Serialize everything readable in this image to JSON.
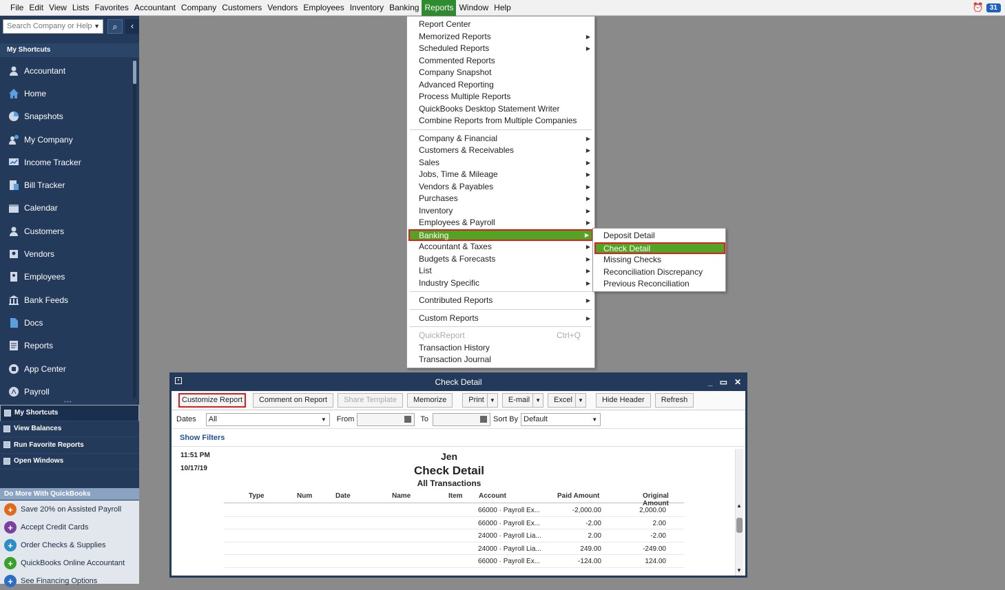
{
  "menubar": {
    "items": [
      "File",
      "Edit",
      "View",
      "Lists",
      "Favorites",
      "Accountant",
      "Company",
      "Customers",
      "Vendors",
      "Employees",
      "Inventory",
      "Banking",
      "Reports",
      "Window",
      "Help"
    ],
    "active_index": 12,
    "badge": "31"
  },
  "sidebar": {
    "search_placeholder": "Search Company or Help",
    "title": "My Shortcuts",
    "items": [
      {
        "label": "Accountant",
        "icon": "person-icon"
      },
      {
        "label": "Home",
        "icon": "home-icon"
      },
      {
        "label": "Snapshots",
        "icon": "pie-chart-icon"
      },
      {
        "label": "My Company",
        "icon": "company-icon"
      },
      {
        "label": "Income Tracker",
        "icon": "income-icon"
      },
      {
        "label": "Bill Tracker",
        "icon": "bill-icon"
      },
      {
        "label": "Calendar",
        "icon": "calendar-icon"
      },
      {
        "label": "Customers",
        "icon": "person-icon"
      },
      {
        "label": "Vendors",
        "icon": "vendor-icon"
      },
      {
        "label": "Employees",
        "icon": "employees-icon"
      },
      {
        "label": "Bank Feeds",
        "icon": "bank-icon"
      },
      {
        "label": "Docs",
        "icon": "doc-icon"
      },
      {
        "label": "Reports",
        "icon": "reports-icon"
      },
      {
        "label": "App Center",
        "icon": "app-icon"
      },
      {
        "label": "Payroll",
        "icon": "payroll-icon"
      }
    ],
    "nav": [
      "My Shortcuts",
      "View Balances",
      "Run Favorite Reports",
      "Open Windows"
    ],
    "domore_title": "Do More With QuickBooks",
    "domore": [
      {
        "label": "Save 20% on Assisted Payroll",
        "color": "#e06a1b"
      },
      {
        "label": "Accept Credit Cards",
        "color": "#7a3fa0"
      },
      {
        "label": "Order Checks & Supplies",
        "color": "#2c8ec4"
      },
      {
        "label": "QuickBooks Online Accountant",
        "color": "#3aa02c"
      },
      {
        "label": "See Financing Options",
        "color": "#2c6ec4"
      }
    ]
  },
  "reports_menu": {
    "items": [
      {
        "label": "Report Center",
        "arrow": false
      },
      {
        "label": "Memorized Reports",
        "arrow": true
      },
      {
        "label": "Scheduled Reports",
        "arrow": true
      },
      {
        "label": "Commented Reports",
        "arrow": false
      },
      {
        "label": "Company Snapshot",
        "arrow": false
      },
      {
        "label": "Advanced Reporting",
        "arrow": false
      },
      {
        "label": "Process Multiple Reports",
        "arrow": false
      },
      {
        "label": "QuickBooks Desktop Statement Writer",
        "arrow": false
      },
      {
        "label": "Combine Reports from Multiple Companies",
        "arrow": false
      },
      {
        "sep": true
      },
      {
        "label": "Company & Financial",
        "arrow": true
      },
      {
        "label": "Customers & Receivables",
        "arrow": true
      },
      {
        "label": "Sales",
        "arrow": true
      },
      {
        "label": "Jobs, Time & Mileage",
        "arrow": true
      },
      {
        "label": "Vendors & Payables",
        "arrow": true
      },
      {
        "label": "Purchases",
        "arrow": true
      },
      {
        "label": "Inventory",
        "arrow": true
      },
      {
        "label": "Employees & Payroll",
        "arrow": true
      },
      {
        "label": "Banking",
        "arrow": true,
        "highlight": true
      },
      {
        "label": "Accountant & Taxes",
        "arrow": true
      },
      {
        "label": "Budgets & Forecasts",
        "arrow": true
      },
      {
        "label": "List",
        "arrow": true
      },
      {
        "label": "Industry Specific",
        "arrow": true
      },
      {
        "sep": true
      },
      {
        "label": "Contributed Reports",
        "arrow": true
      },
      {
        "sep": true
      },
      {
        "label": "Custom Reports",
        "arrow": true
      },
      {
        "sep": true
      },
      {
        "label": "QuickReport",
        "arrow": false,
        "disabled": true,
        "shortcut": "Ctrl+Q"
      },
      {
        "label": "Transaction History",
        "arrow": false
      },
      {
        "label": "Transaction Journal",
        "arrow": false
      }
    ]
  },
  "banking_submenu": [
    "Deposit Detail",
    "Check Detail",
    "Missing Checks",
    "Reconciliation Discrepancy",
    "Previous Reconciliation"
  ],
  "banking_submenu_highlight": 1,
  "report_window": {
    "title": "Check Detail",
    "toolbar": {
      "customize": "Customize Report",
      "comment": "Comment on Report",
      "share": "Share Template",
      "memorize": "Memorize",
      "print": "Print",
      "email": "E-mail",
      "excel": "Excel",
      "hide_header": "Hide Header",
      "refresh": "Refresh"
    },
    "filters": {
      "dates_label": "Dates",
      "dates_value": "All",
      "from_label": "From",
      "to_label": "To",
      "sortby_label": "Sort By",
      "sortby_value": "Default"
    },
    "show_filters": "Show Filters",
    "time": "11:51 PM",
    "date": "10/17/19",
    "company": "Jen",
    "report_title": "Check Detail",
    "subtitle": "All Transactions",
    "columns": [
      "Type",
      "Num",
      "Date",
      "Name",
      "Item",
      "Account",
      "Paid Amount",
      "Original Amount"
    ],
    "rows": [
      {
        "account": "66000 · Payroll Ex...",
        "paid": "-2,000.00",
        "orig": "2,000.00"
      },
      {
        "account": "66000 · Payroll Ex...",
        "paid": "-2.00",
        "orig": "2.00"
      },
      {
        "account": "24000 · Payroll Lia...",
        "paid": "2.00",
        "orig": "-2.00"
      },
      {
        "account": "24000 · Payroll Lia...",
        "paid": "249.00",
        "orig": "-249.00"
      },
      {
        "account": "66000 · Payroll Ex...",
        "paid": "-124.00",
        "orig": "124.00"
      }
    ]
  }
}
